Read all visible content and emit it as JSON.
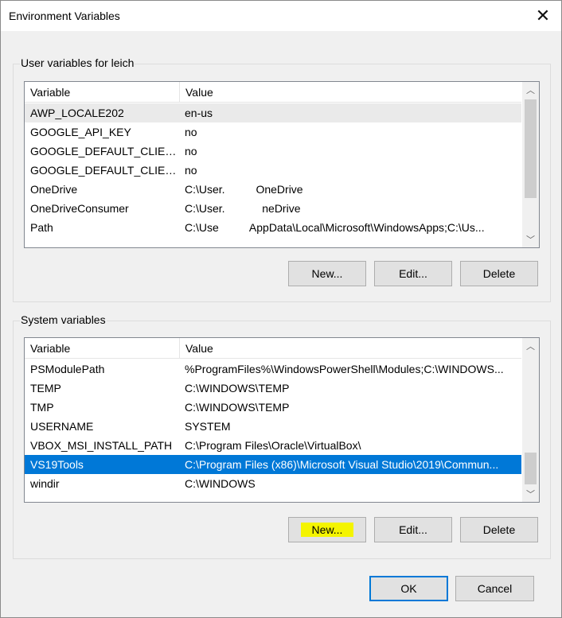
{
  "window": {
    "title": "Environment Variables"
  },
  "user_group": {
    "label": "User variables for leich",
    "columns": [
      "Variable",
      "Value"
    ],
    "rows": [
      {
        "variable": "AWP_LOCALE202",
        "value": "en-us"
      },
      {
        "variable": "GOOGLE_API_KEY",
        "value": "no"
      },
      {
        "variable": "GOOGLE_DEFAULT_CLIENT...",
        "value": "no"
      },
      {
        "variable": "GOOGLE_DEFAULT_CLIENT...",
        "value": "no"
      },
      {
        "variable": "OneDrive",
        "value": "C:\\User.          OneDrive"
      },
      {
        "variable": "OneDriveConsumer",
        "value": "C:\\User.            neDrive"
      },
      {
        "variable": "Path",
        "value": "C:\\Use          AppData\\Local\\Microsoft\\WindowsApps;C:\\Us..."
      }
    ],
    "buttons": {
      "new": "New...",
      "edit": "Edit...",
      "delete": "Delete"
    }
  },
  "system_group": {
    "label": "System variables",
    "columns": [
      "Variable",
      "Value"
    ],
    "rows": [
      {
        "variable": "PSModulePath",
        "value": "%ProgramFiles%\\WindowsPowerShell\\Modules;C:\\WINDOWS..."
      },
      {
        "variable": "TEMP",
        "value": "C:\\WINDOWS\\TEMP"
      },
      {
        "variable": "TMP",
        "value": "C:\\WINDOWS\\TEMP"
      },
      {
        "variable": "USERNAME",
        "value": "SYSTEM"
      },
      {
        "variable": "VBOX_MSI_INSTALL_PATH",
        "value": "C:\\Program Files\\Oracle\\VirtualBox\\"
      },
      {
        "variable": "VS19Tools",
        "value": "C:\\Program Files (x86)\\Microsoft Visual Studio\\2019\\Commun..."
      },
      {
        "variable": "windir",
        "value": "C:\\WINDOWS"
      }
    ],
    "selected_index": 5,
    "buttons": {
      "new": "New...",
      "edit": "Edit...",
      "delete": "Delete"
    }
  },
  "dialog_buttons": {
    "ok": "OK",
    "cancel": "Cancel"
  },
  "icons": {
    "close": "close-icon",
    "scroll_up": "chevron-up-icon",
    "scroll_down": "chevron-down-icon"
  },
  "colors": {
    "selection": "#0078d7",
    "highlight": "#f4f400",
    "hover_row": "#eaeaea"
  }
}
